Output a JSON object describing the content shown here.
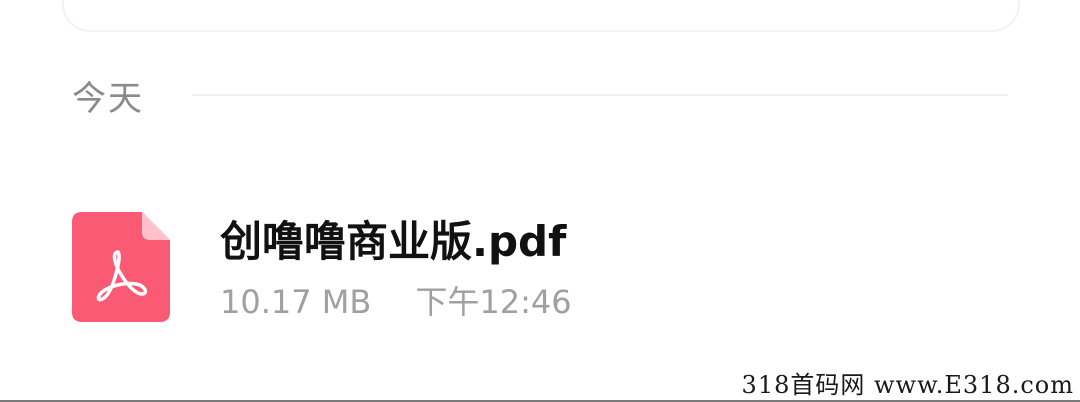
{
  "section": {
    "title": "今天"
  },
  "file": {
    "name": "创噜噜商业版.pdf",
    "size": "10.17 MB",
    "time": "下午12:46",
    "icon": "pdf-file-icon",
    "icon_color": "#fb5a74"
  },
  "watermark": {
    "text": "318首码网 www.E318.com"
  }
}
